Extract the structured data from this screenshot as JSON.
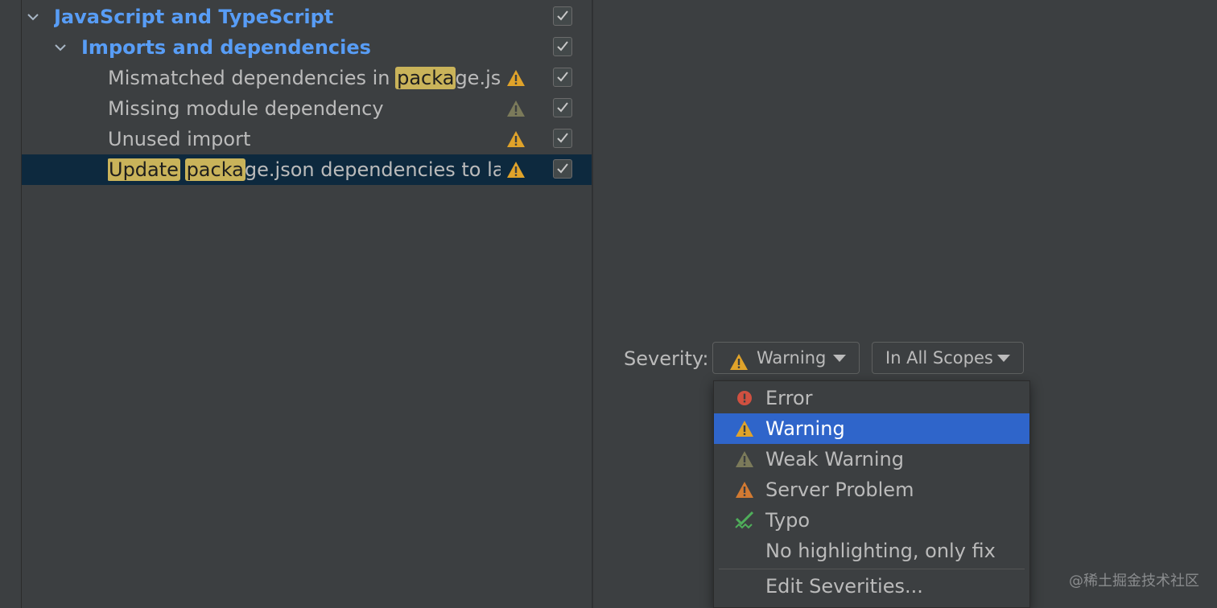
{
  "tree": {
    "group_1": {
      "label": "JavaScript and TypeScript",
      "checked": true
    },
    "group_2": {
      "label": "Imports and dependencies",
      "checked": true
    },
    "items": [
      {
        "parts": [
          "Mismatched dependencies in ",
          "packa",
          "ge.jso"
        ],
        "highlight": [
          1
        ],
        "icon": "warning-icon",
        "checked": true,
        "selected": false
      },
      {
        "parts": [
          "Missing module dependency"
        ],
        "highlight": [],
        "icon": "weak-warning-icon",
        "checked": true,
        "selected": false
      },
      {
        "parts": [
          "Unused import"
        ],
        "highlight": [],
        "icon": "warning-icon",
        "checked": true,
        "selected": false
      },
      {
        "parts": [
          "Update",
          " ",
          "packa",
          "ge.json dependencies to lat"
        ],
        "highlight": [
          0,
          2
        ],
        "icon": "warning-icon",
        "checked": true,
        "selected": true
      }
    ]
  },
  "severity": {
    "label": "Severity:",
    "selected": "Warning",
    "scope": "In All Scopes",
    "options": [
      {
        "label": "Error",
        "icon": "error-icon",
        "active": false
      },
      {
        "label": "Warning",
        "icon": "warning-icon",
        "active": true
      },
      {
        "label": "Weak Warning",
        "icon": "weak-warning-icon",
        "active": false
      },
      {
        "label": "Server Problem",
        "icon": "server-problem-icon",
        "active": false
      },
      {
        "label": "Typo",
        "icon": "typo-icon",
        "active": false
      },
      {
        "label": "No highlighting, only fix",
        "icon": "",
        "active": false
      }
    ],
    "edit_label": "Edit Severities..."
  },
  "colors": {
    "warning": "#e0a32a",
    "weak_warning": "#7b7a5a",
    "error": "#d05040",
    "server_problem": "#d27a32",
    "typo": "#4fae5a",
    "selection": "#2f65ca",
    "tree_selection": "#0d293e"
  },
  "watermark": "@稀土掘金技术社区"
}
